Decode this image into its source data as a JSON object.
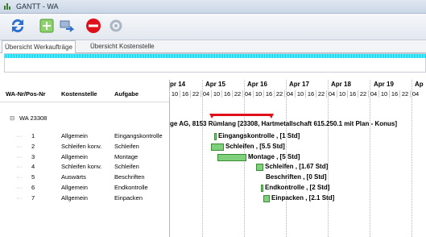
{
  "window": {
    "title": "GANTT - WA"
  },
  "tabs": [
    "Übersicht Werkaufträge",
    "Übersicht Kostenstelle"
  ],
  "columns": {
    "pos": "WA-Nr/Pos-Nr",
    "kostenstelle": "Kostenstelle",
    "aufgabe": "Aufgabe"
  },
  "wa": {
    "label": "WA 23308",
    "summary": "ge AG, 8153 Rümlang [23308, Hartmetallschaft 615.250.1 mit Plan - Konus]"
  },
  "days": [
    "pr 14",
    "Apr 15",
    "Apr 16",
    "Apr 17",
    "Apr 18",
    "Apr 19",
    "Ap"
  ],
  "hours": [
    "10",
    "16",
    "22",
    "04",
    "10",
    "16",
    "22",
    "04",
    "10",
    "16",
    "22",
    "04",
    "10",
    "16",
    "22",
    "04",
    "10",
    "16",
    "22",
    "04",
    "10",
    "16",
    "22",
    "04"
  ],
  "rows": [
    {
      "pos": "1",
      "kostenstelle": "Allgemein",
      "aufgabe": "Eingangskontrolle",
      "gantt": "Eingangskontrolle , [1 Std]"
    },
    {
      "pos": "2",
      "kostenstelle": "Schleifen konv.",
      "aufgabe": "Schleifen",
      "gantt": "Schleifen , [5.5 Std]"
    },
    {
      "pos": "3",
      "kostenstelle": "Allgemein",
      "aufgabe": "Montage",
      "gantt": "Montage , [5 Std]"
    },
    {
      "pos": "4",
      "kostenstelle": "Schleifen konv.",
      "aufgabe": "Schleifen",
      "gantt": "Schleifen , [1.67 Std]"
    },
    {
      "pos": "5",
      "kostenstelle": "Auswärts",
      "aufgabe": "Beschriften",
      "gantt": "Beschriften , [0 Std]"
    },
    {
      "pos": "6",
      "kostenstelle": "Allgemein",
      "aufgabe": "Endkontrolle",
      "gantt": "Endkontrolle , [2 Std]"
    },
    {
      "pos": "7",
      "kostenstelle": "Allgemein",
      "aufgabe": "Einpacken",
      "gantt": "Einpacken , [2.1 Std]"
    }
  ],
  "colors": {
    "bar": "#7ed07a",
    "summary": "#e0101a",
    "strip": "#1cc5ea"
  }
}
